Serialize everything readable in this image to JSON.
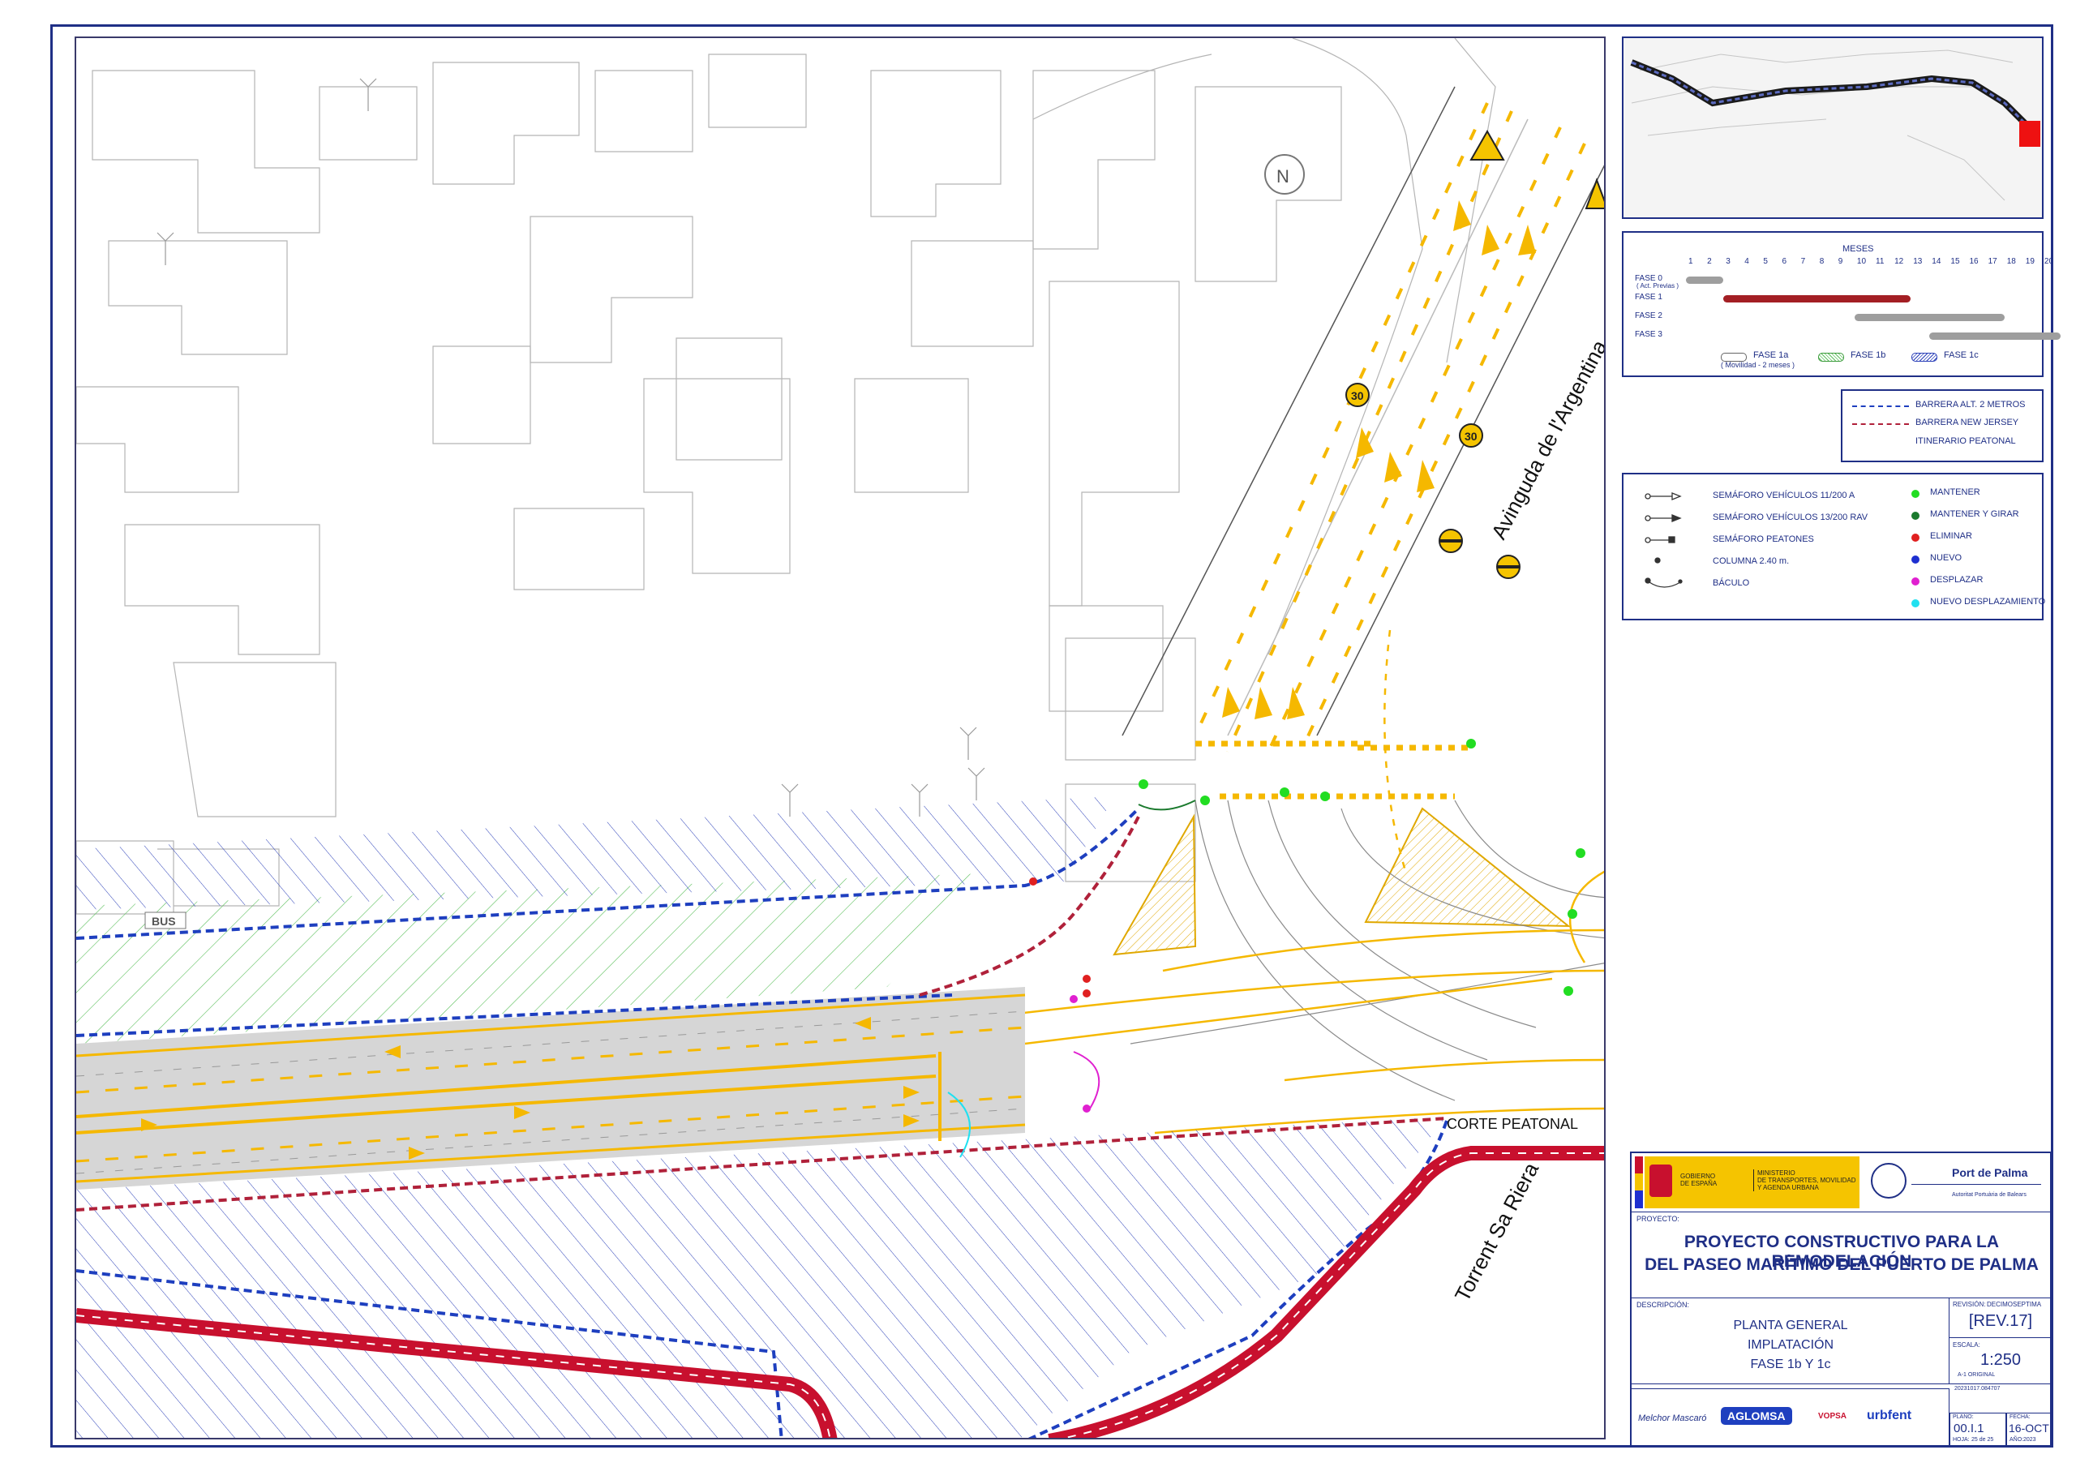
{
  "street_labels": {
    "argentina": "Avinguda de l'Argentina",
    "torrent": "Torrent Sa Riera",
    "corte": "CORTE PEATONAL",
    "bus": "BUS"
  },
  "speed_signs": [
    "30",
    "30"
  ],
  "schedule": {
    "header": "MESES",
    "months": [
      "1",
      "2",
      "3",
      "4",
      "5",
      "6",
      "7",
      "8",
      "9",
      "10",
      "11",
      "12",
      "13",
      "14",
      "15",
      "16",
      "17",
      "18",
      "19",
      "20"
    ],
    "phases": [
      {
        "label": "FASE 0",
        "sublabel": "( Act. Previas )",
        "start": 1,
        "end": 2,
        "color": "#9e9e9e"
      },
      {
        "label": "FASE 1",
        "sublabel": "",
        "start": 3,
        "end": 12,
        "color": "#a31f24"
      },
      {
        "label": "FASE 2",
        "sublabel": "",
        "start": 10,
        "end": 17,
        "color": "#9e9e9e"
      },
      {
        "label": "FASE 3",
        "sublabel": "",
        "start": 14,
        "end": 20,
        "color": "#9e9e9e"
      }
    ],
    "key": [
      {
        "label": "FASE 1a",
        "note": "( Movilidad - 2 meses )"
      },
      {
        "label": "FASE 1b",
        "note": ""
      },
      {
        "label": "FASE 1c",
        "note": ""
      }
    ]
  },
  "barriers": [
    {
      "label": "BARRERA ALT. 2 METROS",
      "color": "#1e3fbf"
    },
    {
      "label": "BARRERA NEW JERSEY",
      "color": "#b0213a"
    },
    {
      "label": "ITINERARIO  PEATONAL",
      "color": ""
    }
  ],
  "signals_legend": [
    {
      "label": "SEMÁFORO VEHÍCULOS 11/200 A"
    },
    {
      "label": "SEMÁFORO VEHÍCULOS 13/200 RAV"
    },
    {
      "label": "SEMÁFORO PEATONES"
    },
    {
      "label": "COLUMNA 2.40 m."
    },
    {
      "label": "BÁCULO"
    }
  ],
  "status_legend": [
    {
      "label": "MANTENER",
      "color": "#22dd22"
    },
    {
      "label": "MANTENER Y GIRAR",
      "color": "#1b7a2e"
    },
    {
      "label": "ELIMINAR",
      "color": "#e02020"
    },
    {
      "label": "NUEVO",
      "color": "#1e2fd0"
    },
    {
      "label": "DESPLAZAR",
      "color": "#e020d0"
    },
    {
      "label": "NUEVO DESPLAZAMIENTO",
      "color": "#20e0f0"
    }
  ],
  "title_block": {
    "gov1": "GOBIERNO\nDE ESPAÑA",
    "gov2": "MINISTERIO\nDE TRANSPORTES, MOVILIDAD\nY AGENDA URBANA",
    "port": "Port de Palma",
    "port_sub": "Autoritat Portuària de Balears",
    "proyecto_label": "PROYECTO:",
    "project_title_1": "PROYECTO CONSTRUCTIVO PARA LA REMODELACIÓN",
    "project_title_2": "DEL PASEO MARÍTIMO DEL PUERTO DE PALMA",
    "descripcion_label": "DESCRIPCIÓN:",
    "desc_1": "PLANTA GENERAL",
    "desc_2": "IMPLATACIÓN",
    "desc_3": "FASE 1b Y 1c",
    "revision_label": "REVISIÓN:",
    "revision_word": "DECIMOSEPTIMA",
    "revision": "[REV.17]",
    "escala_label": "ESCALA:",
    "escala": "1:250",
    "escala_note": "A-1 ORIGINAL",
    "file_code": "20231017.084707",
    "plano_label": "PLANO:",
    "plano": "00.I.1",
    "hoja_label": "HOJA:",
    "hoja": "25 de 25",
    "fecha_label": "FECHA:",
    "fecha": "16-OCT",
    "ano_label": "AÑO:",
    "ano": "2023",
    "firms": [
      "Melchor Mascaró",
      "AGLOMSA",
      "VOPSA",
      "urbfent"
    ]
  }
}
